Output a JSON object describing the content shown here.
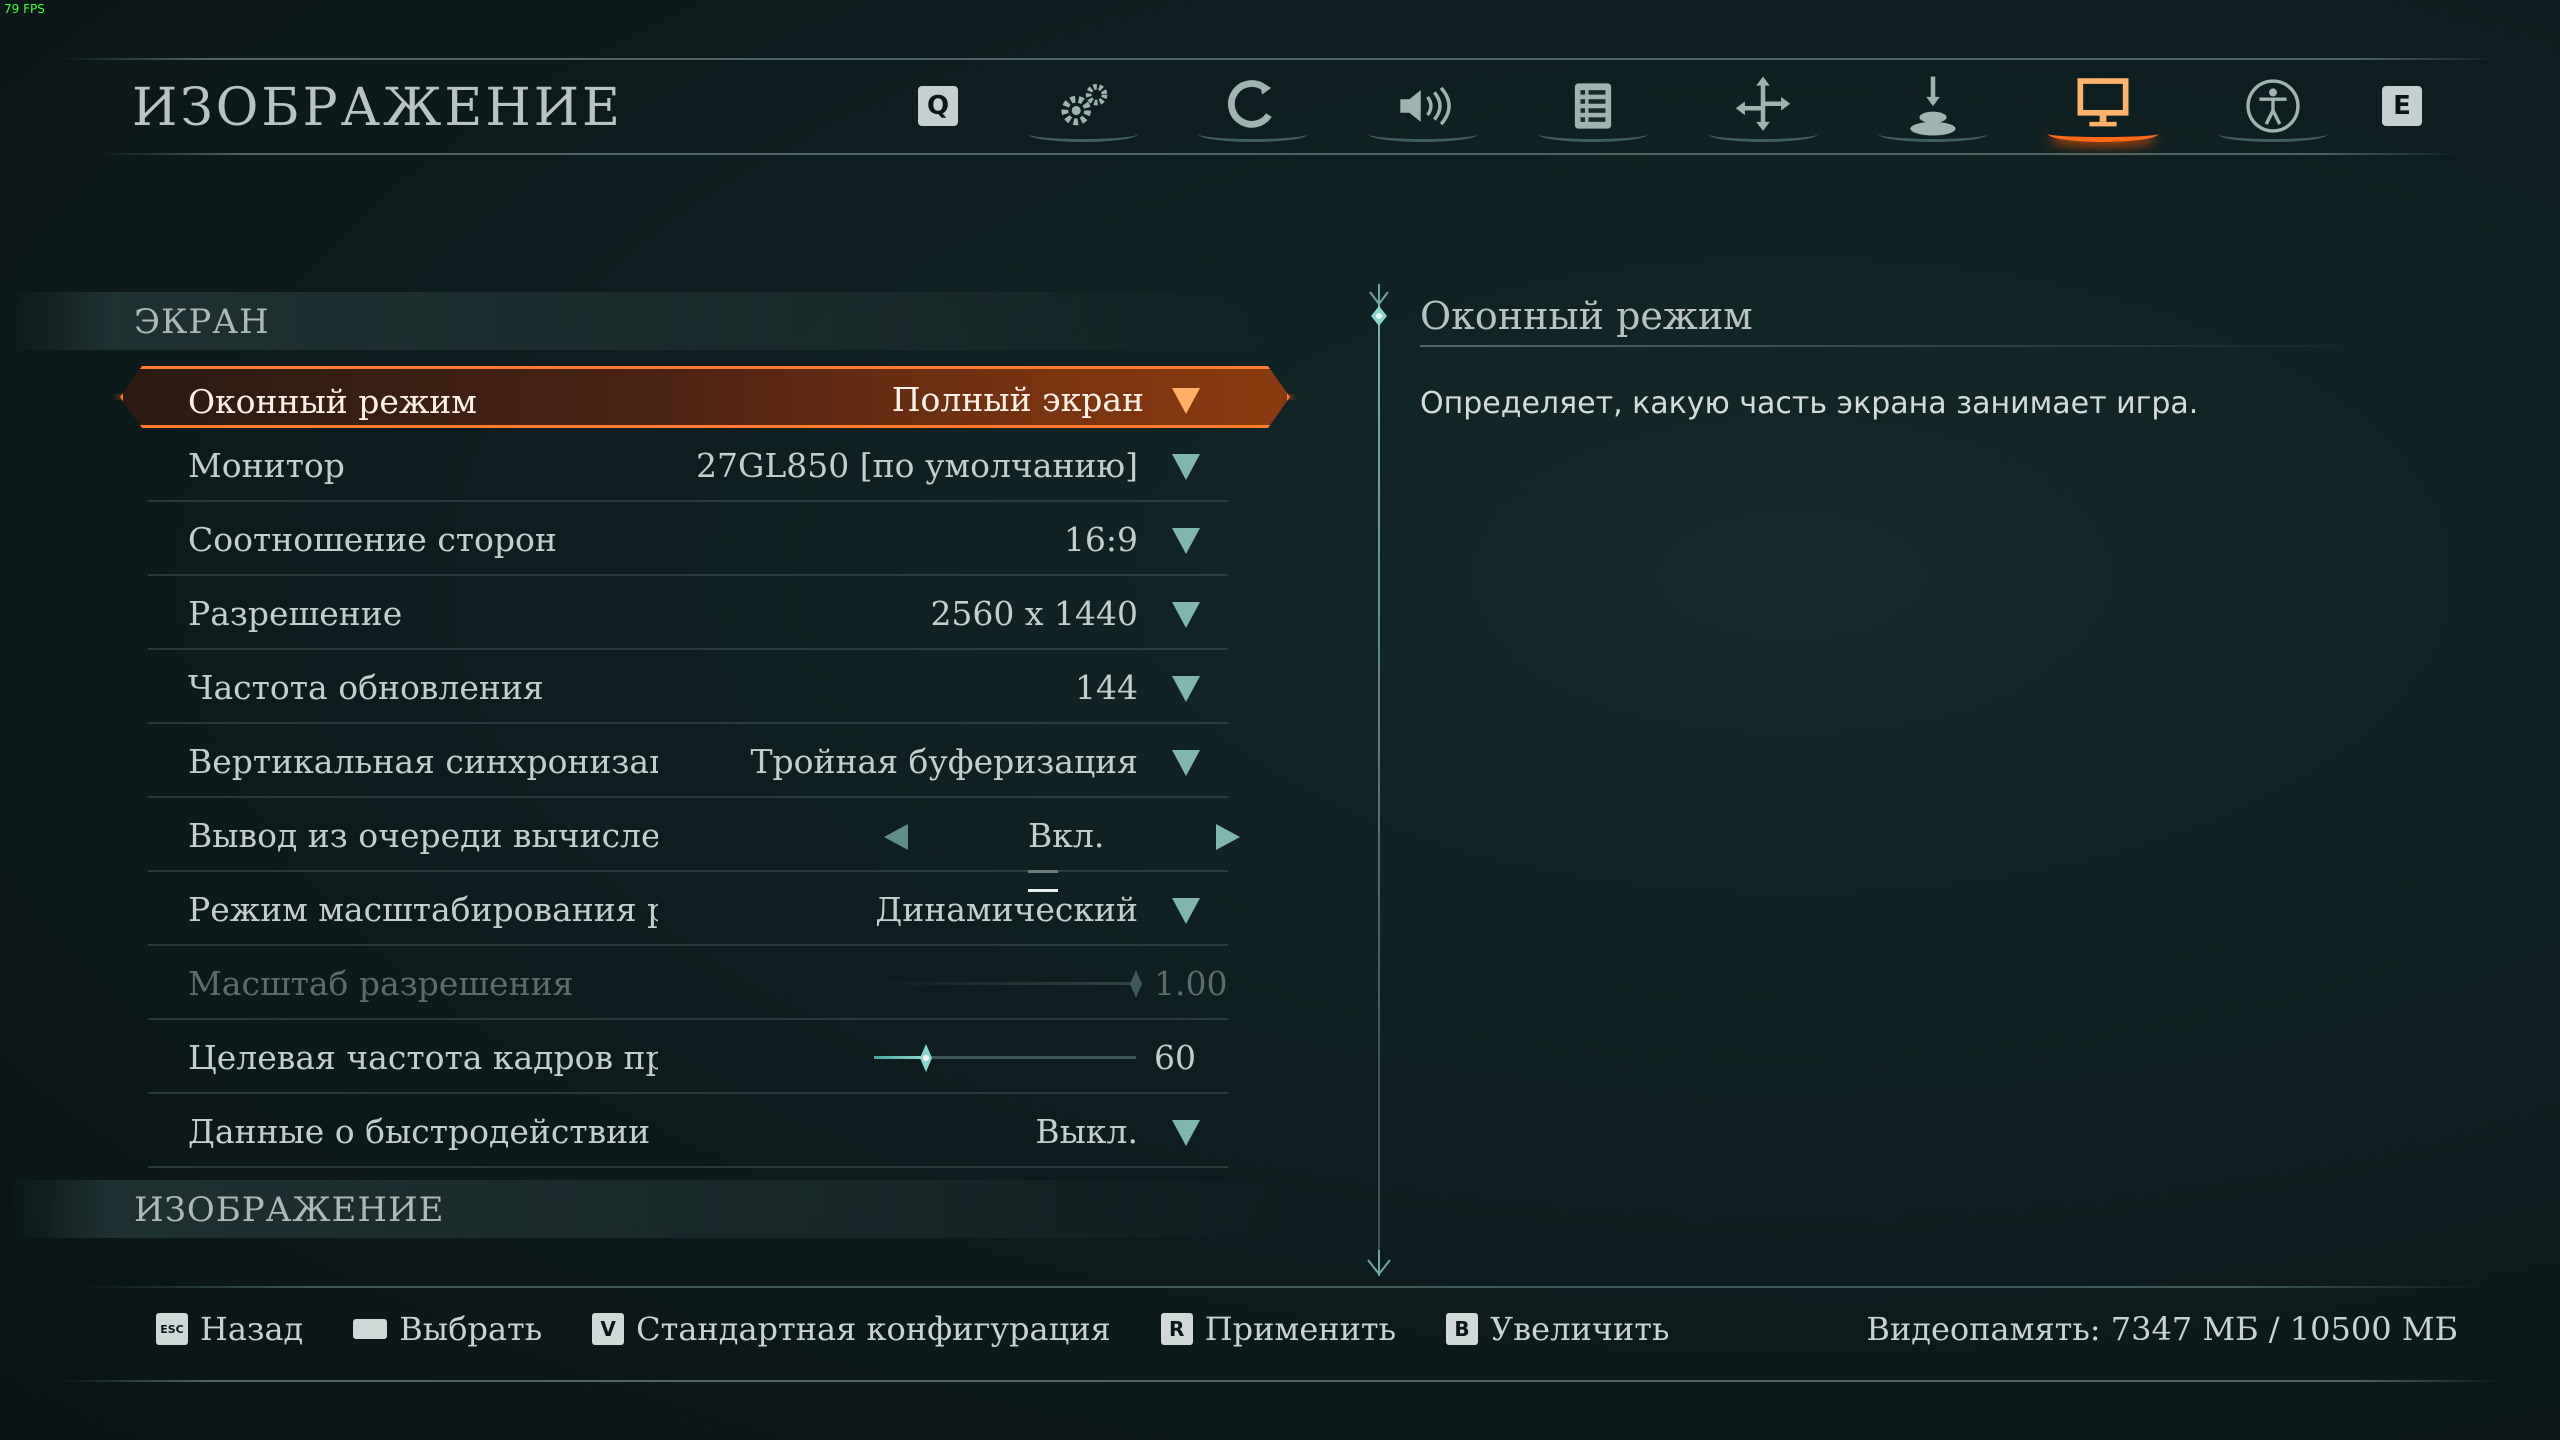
{
  "fps": "79 FPS",
  "page_title": "ИЗОБРАЖЕНИЕ",
  "tabs": {
    "prev_key": "Q",
    "next_key": "E",
    "items": [
      {
        "name": "gameplay",
        "icon": "gears-icon"
      },
      {
        "name": "controls",
        "icon": "hook-icon"
      },
      {
        "name": "audio",
        "icon": "speaker-icon"
      },
      {
        "name": "hud",
        "icon": "list-icon"
      },
      {
        "name": "camera",
        "icon": "move-arrows-icon"
      },
      {
        "name": "input",
        "icon": "joystick-icon"
      },
      {
        "name": "display",
        "icon": "monitor-icon",
        "active": true
      },
      {
        "name": "accessibility",
        "icon": "accessibility-icon"
      }
    ]
  },
  "sections": {
    "screen": "ЭКРАН",
    "image": "ИЗОБРАЖЕНИЕ"
  },
  "settings": [
    {
      "label": "Оконный режим",
      "value": "Полный экран",
      "type": "dropdown",
      "selected": true
    },
    {
      "label": "Монитор",
      "value": "27GL850 [по умолчанию]",
      "type": "dropdown"
    },
    {
      "label": "Соотношение сторон",
      "value": "16:9",
      "type": "dropdown"
    },
    {
      "label": "Разрешение",
      "value": "2560 x 1440",
      "type": "dropdown"
    },
    {
      "label": "Частота обновления",
      "value": "144",
      "type": "dropdown"
    },
    {
      "label": "Вертикальная синхронизация",
      "value": "Тройная буферизация",
      "type": "dropdown"
    },
    {
      "label": "Вывод из очереди вычислени",
      "value": "Вкл.",
      "type": "toggle"
    },
    {
      "label": "Режим масштабирования разр",
      "value": "Динамический",
      "type": "dropdown"
    },
    {
      "label": "Масштаб разрешения",
      "value": "1.00",
      "type": "slider",
      "disabled": true,
      "level": 1.0
    },
    {
      "label": "Целевая частота кадров при",
      "value": "60",
      "type": "slider",
      "level": 0.2
    },
    {
      "label": "Данные о быстродействии",
      "value": "Выкл.",
      "type": "dropdown"
    }
  ],
  "detail": {
    "title": "Оконный режим",
    "description": "Определяет, какую часть экрана занимает игра."
  },
  "footer": {
    "back": {
      "key": "ESC",
      "label": "Назад"
    },
    "select": {
      "key": "",
      "label": "Выбрать"
    },
    "defaults": {
      "key": "V",
      "label": "Стандартная конфигурация"
    },
    "apply": {
      "key": "R",
      "label": "Применить"
    },
    "zoom": {
      "key": "B",
      "label": "Увеличить"
    },
    "vram": "Видеопамять: 7347 МБ / 10500 МБ"
  },
  "colors": {
    "accent": "#ff6a1a",
    "teal": "#6fc7bd"
  }
}
